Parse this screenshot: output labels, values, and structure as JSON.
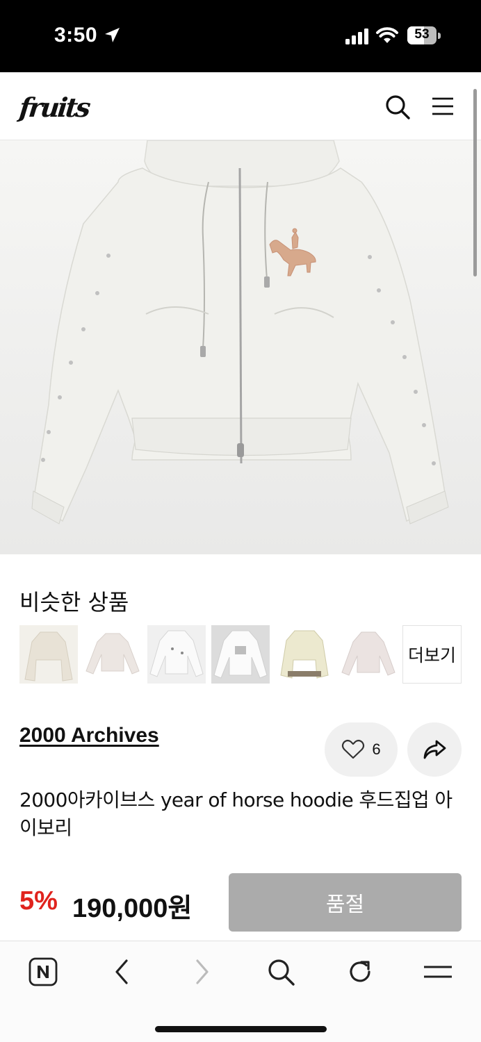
{
  "status_bar": {
    "time": "3:50",
    "battery": "53"
  },
  "header": {
    "logo": "fruits"
  },
  "similar": {
    "title": "비슷한 상품",
    "more_label": "더보기"
  },
  "product": {
    "brand": "2000 Archives",
    "likes": "6",
    "name": "2000아카이브스 year of horse hoodie 후드집업 아이보리",
    "discount": "5%",
    "price": "190,000원",
    "soldout_label": "품절"
  },
  "colors": {
    "discount": "#e0231d",
    "soldout_bg": "#ababab"
  }
}
